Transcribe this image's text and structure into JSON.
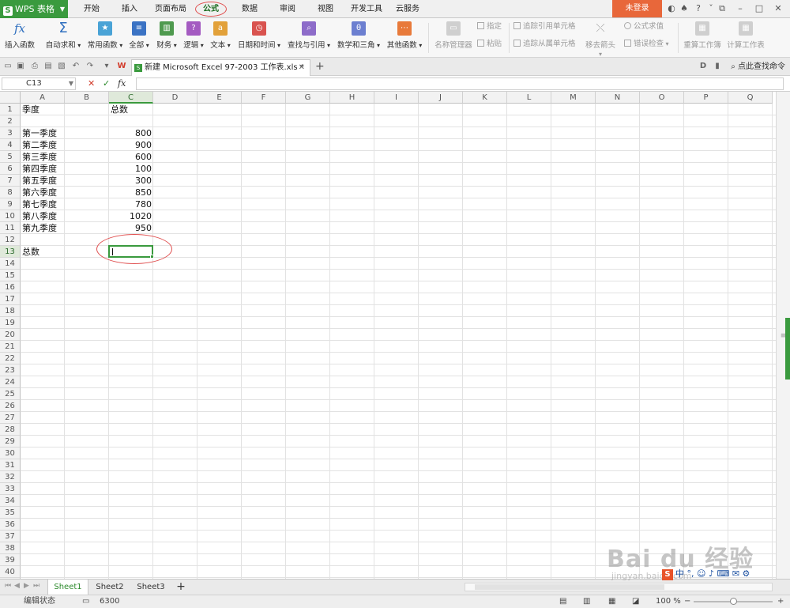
{
  "app": {
    "name": "WPS 表格",
    "menu_tabs": [
      "开始",
      "插入",
      "页面布局",
      "公式",
      "数据",
      "审阅",
      "视图",
      "开发工具",
      "云服务"
    ],
    "active_tab": "公式",
    "login_label": "未登录"
  },
  "ribbon": {
    "insert_function": "插入函数",
    "fx_symbol": "fx",
    "autosum": "自动求和",
    "autosum_symbol": "Σ",
    "common": "常用函数",
    "all": "全部",
    "finance": "财务",
    "logic": "逻辑",
    "text": "文本",
    "datetime": "日期和时间",
    "lookup": "查找与引用",
    "math": "数学和三角",
    "other": "其他函数",
    "name_manager": "名称管理器",
    "specify": "指定",
    "paste": "粘贴",
    "trace_precedents": "追踪引用单元格",
    "trace_dependents": "追踪从属单元格",
    "remove_arrows": "移去箭头",
    "evaluate": "公式求值",
    "error_check": "错误检查",
    "recalc_sheet": "重算工作簿",
    "calc_sheet": "计算工作表"
  },
  "document": {
    "tab_title": "新建 Microsoft Excel 97-2003 工作表.xls *",
    "search_command": "点此查找命令"
  },
  "formula_bar": {
    "name_box": "C13",
    "cancel": "✕",
    "confirm": "✓",
    "fx": "fx"
  },
  "columns": [
    "A",
    "B",
    "C",
    "D",
    "E",
    "F",
    "G",
    "H",
    "I",
    "J",
    "K",
    "L",
    "M",
    "N",
    "O",
    "P",
    "Q"
  ],
  "rows_count": 41,
  "selected": {
    "column": "C",
    "row": 13
  },
  "cells": {
    "A1": "季度",
    "C1": "总数",
    "A3": "第一季度",
    "C3": "800",
    "A4": "第二季度",
    "C4": "900",
    "A5": "第三季度",
    "C5": "600",
    "A6": "第四季度",
    "C6": "100",
    "A7": "第五季度",
    "C7": "300",
    "A8": "第六季度",
    "C8": "850",
    "A9": "第七季度",
    "C9": "780",
    "A10": "第八季度",
    "C10": "1020",
    "A11": "第九季度",
    "C11": "950",
    "A13": "总数"
  },
  "sheets": [
    "Sheet1",
    "Sheet2",
    "Sheet3"
  ],
  "active_sheet": "Sheet1",
  "status": {
    "mode": "编辑状态",
    "value": "6300",
    "zoom": "100 %"
  },
  "watermark": {
    "brand": "Bai du 经验",
    "url": "jingyan.baidu.com"
  },
  "ime": {
    "logo": "S",
    "text": "中 °, ☺ ♪ ⌨ ✉ ⚙"
  },
  "colors": {
    "brand_green": "#3a9a3e",
    "login_orange": "#e8673a",
    "annotation_red": "#e05050"
  }
}
